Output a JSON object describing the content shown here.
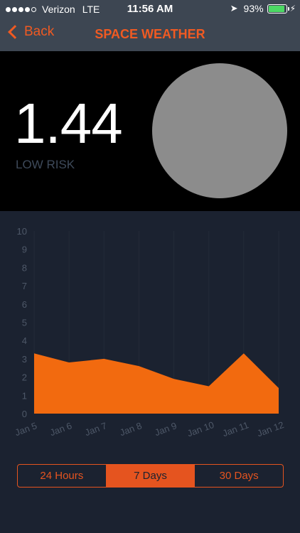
{
  "status_bar": {
    "carrier": "Verizon",
    "network": "LTE",
    "time": "11:56 AM",
    "battery_text": "93%",
    "battery_level": 0.93,
    "signal_bars": 4,
    "signal_total": 5
  },
  "nav": {
    "back_label": "Back",
    "title": "SPACE WEATHER"
  },
  "hero": {
    "value": "1.44",
    "risk": "LOW RISK"
  },
  "colors": {
    "accent": "#f05a22",
    "chart_fill": "#f26a0f",
    "background": "#1b2230",
    "header": "#3d4652",
    "disc": "#8c8c8c"
  },
  "chart_data": {
    "type": "area",
    "x": [
      "Jan 5",
      "Jan 6",
      "Jan 7",
      "Jan 8",
      "Jan 9",
      "Jan 10",
      "Jan 11",
      "Jan 12"
    ],
    "values": [
      3.3,
      2.8,
      3.0,
      2.6,
      1.9,
      1.5,
      3.3,
      1.4
    ],
    "y_ticks": [
      "0",
      "1",
      "2",
      "3",
      "4",
      "5",
      "6",
      "7",
      "8",
      "9",
      "10"
    ],
    "ylim": [
      0,
      10
    ],
    "grid": "vertical",
    "title": "",
    "xlabel": "",
    "ylabel": ""
  },
  "range_selector": {
    "options": [
      "24 Hours",
      "7 Days",
      "30 Days"
    ],
    "selected": 1
  }
}
